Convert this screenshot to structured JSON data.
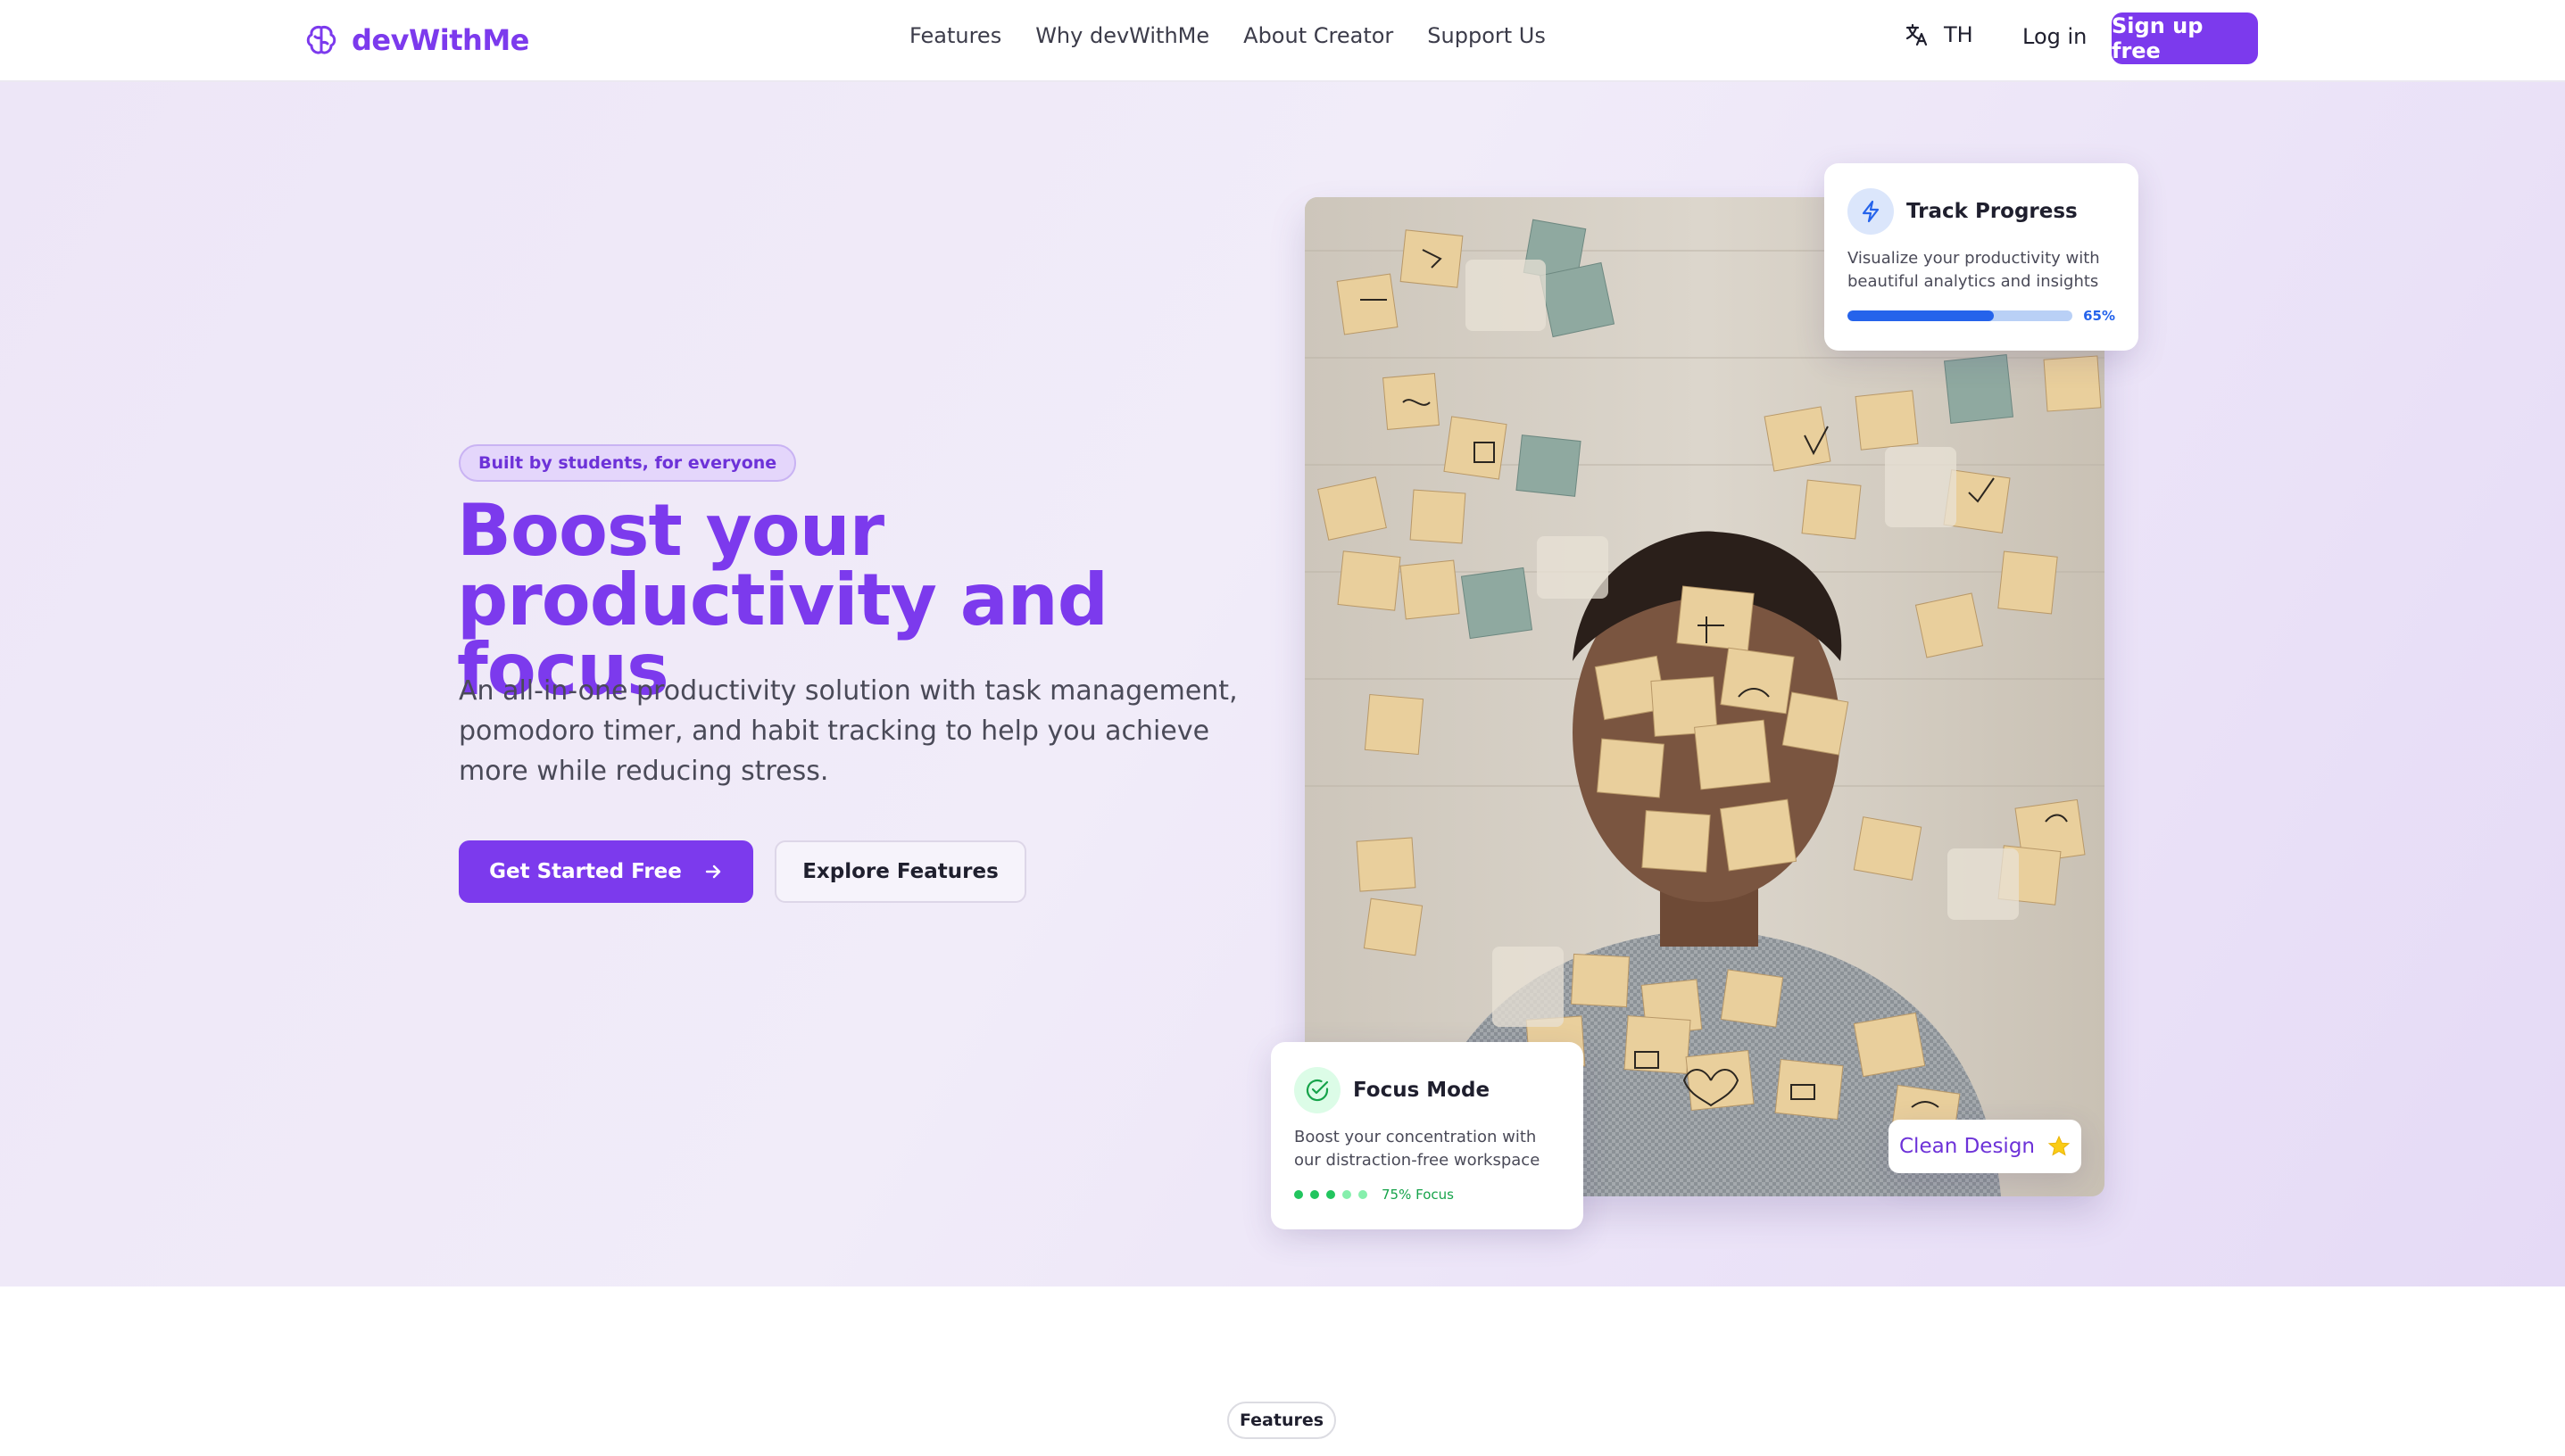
{
  "brand": {
    "name": "devWithMe",
    "color": "#7c3aed"
  },
  "nav": {
    "links": [
      "Features",
      "Why devWithMe",
      "About Creator",
      "Support Us"
    ],
    "language": "TH",
    "login": "Log in",
    "signup": "Sign up free"
  },
  "hero": {
    "badge": "Built by students, for everyone",
    "headline": "Boost your productivity and focus",
    "subtext": "An all-in-one productivity solution with task management, pomodoro timer, and habit tracking to help you achieve more while reducing stress.",
    "primary_cta": "Get Started Free",
    "secondary_cta": "Explore Features"
  },
  "cards": {
    "track": {
      "title": "Track Progress",
      "text": "Visualize your productivity with beautiful analytics and insights",
      "progress": 0.65,
      "progress_label": "65%"
    },
    "focus": {
      "title": "Focus Mode",
      "text": "Boost your concentration with our distraction-free workspace",
      "label": "75% Focus"
    },
    "clean": {
      "label": "Clean Design"
    }
  },
  "sections": {
    "features_pill": "Features"
  },
  "icons": [
    "brain-icon",
    "translate-icon",
    "arrow-right-icon",
    "lightning-icon",
    "check-circle-icon",
    "star-icon"
  ]
}
